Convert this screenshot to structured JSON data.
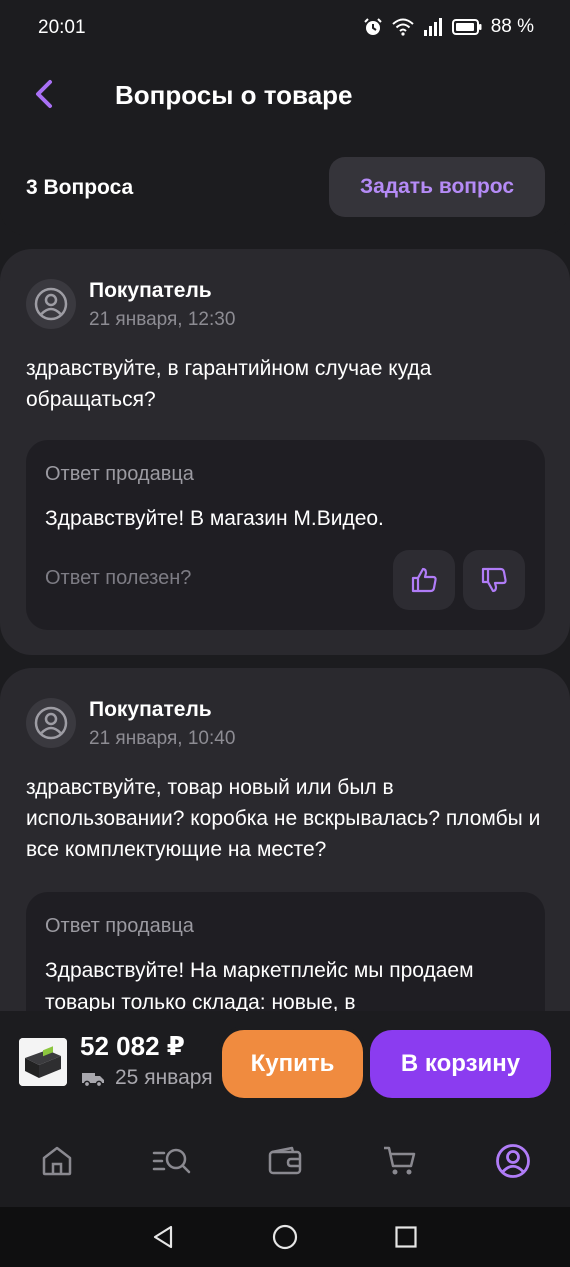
{
  "status_bar": {
    "time": "20:01",
    "battery": "88 %"
  },
  "header": {
    "title": "Вопросы о товаре",
    "count": "3 Вопроса",
    "ask_button": "Задать вопрос"
  },
  "questions": [
    {
      "author": "Покупатель",
      "date": "21 января, 12:30",
      "text": "здравствуйте, в гарантийном случае куда обращаться?",
      "answer": {
        "title": "Ответ продавца",
        "text": "Здравствуйте!  В магазин М.Видео.",
        "helpful_prompt": "Ответ полезен?"
      }
    },
    {
      "author": "Покупатель",
      "date": "21 января, 10:40",
      "text": "здравствуйте, товар новый или был в использовании? коробка не вскрывалась? пломбы и все комплектующие на месте?",
      "answer": {
        "title": "Ответ продавца",
        "text": "Здравствуйте! На маркетплейс мы продаем товары только склада: новые, в"
      }
    }
  ],
  "buy_bar": {
    "price": "52 082 ₽",
    "delivery": "25 января",
    "buy_button": "Купить",
    "cart_button": "В корзину"
  },
  "tabs": [
    "home-icon",
    "catalog-search-icon",
    "wallet-icon",
    "cart-icon",
    "profile-icon"
  ],
  "colors": {
    "accent": "#8b3cf0",
    "accent_text": "#b58bf6",
    "buy": "#f08b3f",
    "background": "#1c1c1f",
    "card": "#2a292e"
  }
}
